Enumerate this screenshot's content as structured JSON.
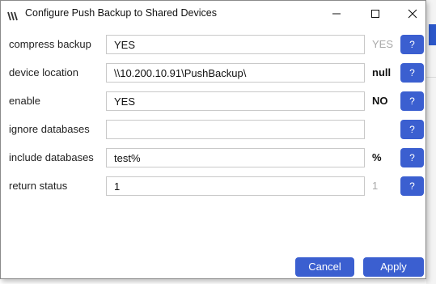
{
  "window": {
    "title": "Configure Push Backup to Shared Devices"
  },
  "settings": [
    {
      "label": "compress backup",
      "value": "YES",
      "current": "YES",
      "current_style": "muted",
      "help": "?"
    },
    {
      "label": "device location",
      "value": "\\\\10.200.10.91\\PushBackup\\",
      "current": "null",
      "current_style": "bold",
      "help": "?"
    },
    {
      "label": "enable",
      "value": "YES",
      "current": "NO",
      "current_style": "bold",
      "help": "?"
    },
    {
      "label": "ignore databases",
      "value": "",
      "current": "",
      "current_style": "muted",
      "help": "?"
    },
    {
      "label": "include databases",
      "value": "test%",
      "current": "%",
      "current_style": "bold",
      "help": "?"
    },
    {
      "label": "return status",
      "value": "1",
      "current": "1",
      "current_style": "muted",
      "help": "?"
    }
  ],
  "footer": {
    "cancel_label": "Cancel",
    "apply_label": "Apply"
  },
  "colors": {
    "accent": "#3b5fd0"
  },
  "icons": {
    "app": "app-logo-icon",
    "minimize": "minimize-icon",
    "maximize": "maximize-icon",
    "close": "close-icon"
  }
}
